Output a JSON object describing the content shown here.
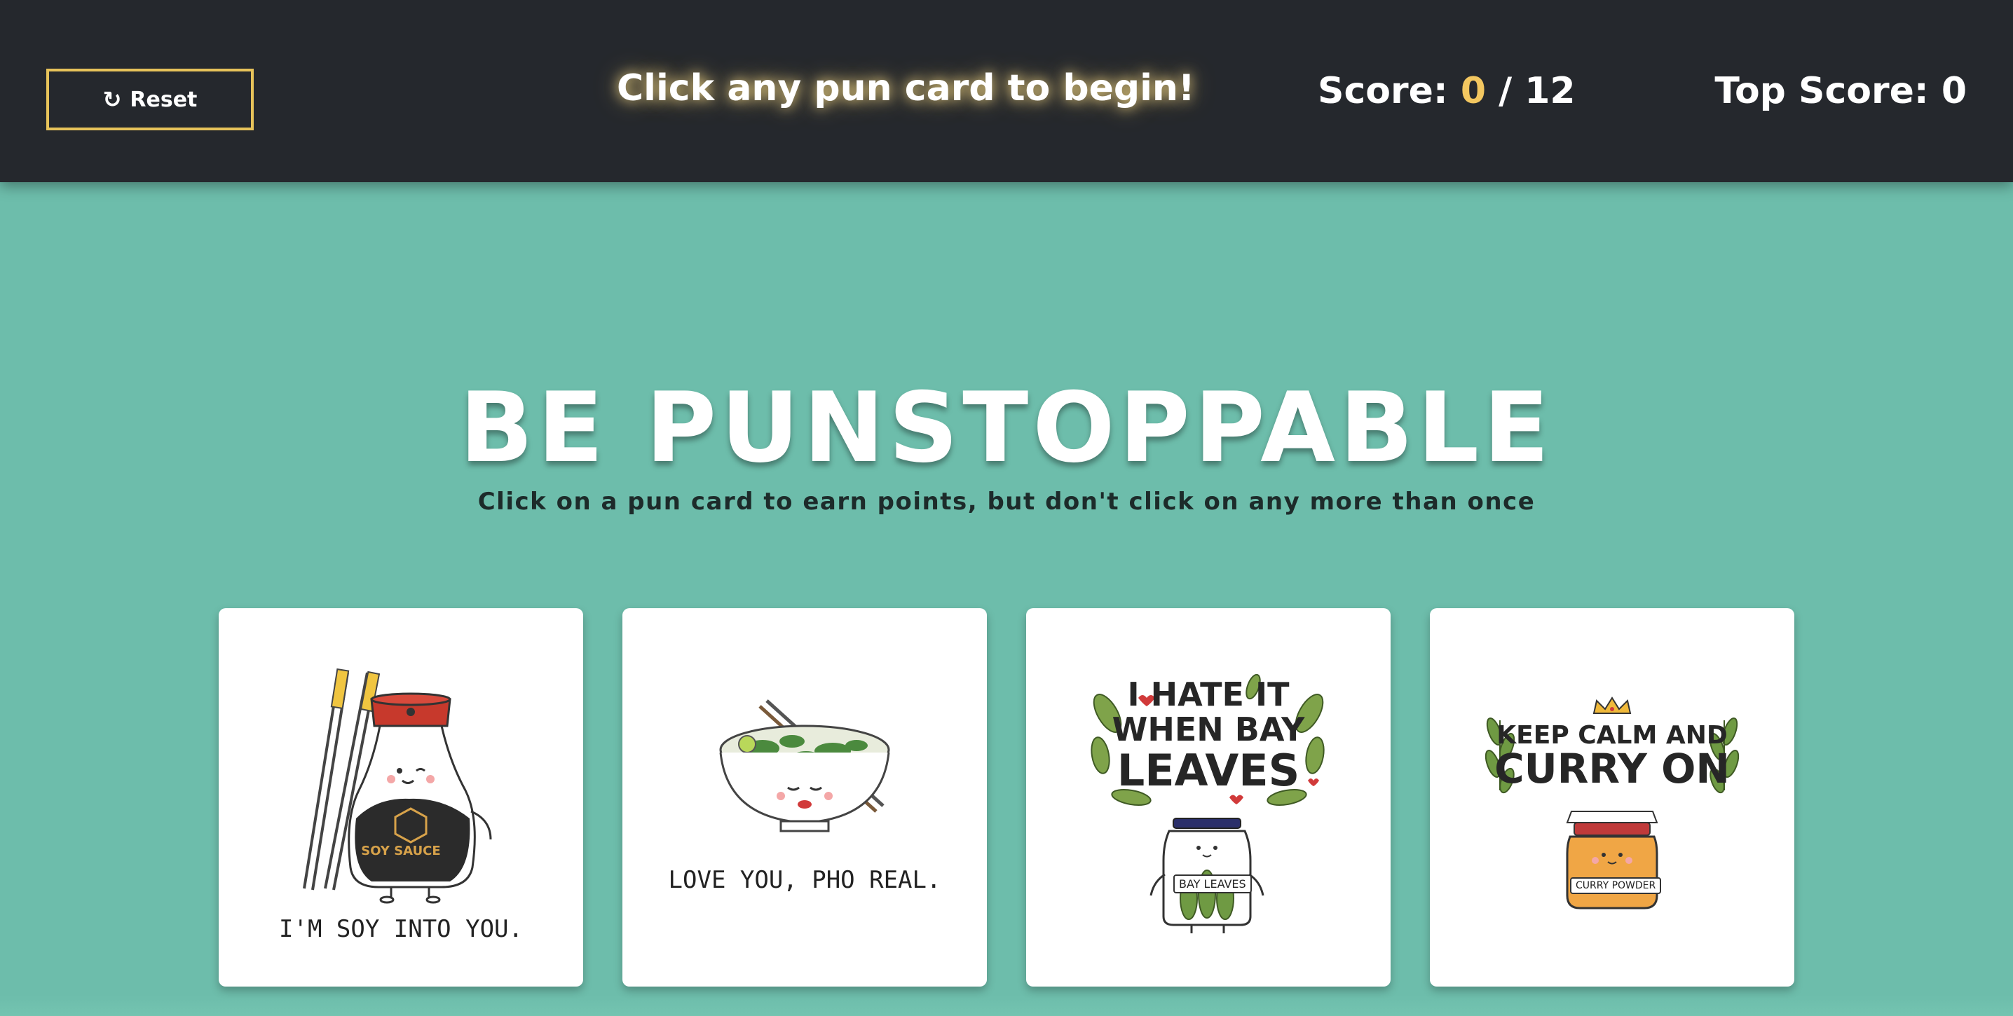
{
  "navbar": {
    "reset_label": "Reset",
    "reset_icon": "refresh-icon",
    "message": "Click any pun card to begin!",
    "score_label": "Score: ",
    "score_current": "0",
    "score_separator": " / ",
    "score_total": "12",
    "top_score_label": "Top Score: ",
    "top_score_value": "0"
  },
  "hero": {
    "title": "BE PUNSTOPPABLE",
    "subtitle": "Click on a pun card to earn points, but don't click on any more than once"
  },
  "cards": [
    {
      "caption": "I'M SOY INTO YOU.",
      "bottle_label": "SOY SAUCE",
      "icon": "soy-sauce-illustration"
    },
    {
      "caption": "LOVE YOU, PHO REAL.",
      "icon": "pho-bowl-illustration"
    },
    {
      "line1": "I HATE IT",
      "line2": "WHEN BAY",
      "line3": "LEAVES",
      "jar_label": "BAY LEAVES",
      "icon": "bay-leaves-jar-illustration"
    },
    {
      "line1": "KEEP CALM AND",
      "line2": "CURRY ON",
      "jar_label": "CURRY POWDER",
      "icon": "curry-powder-jar-illustration"
    }
  ],
  "colors": {
    "background": "#6dbdab",
    "navbar": "#25282d",
    "accent": "#e7c35a",
    "score_highlight": "#f3c760"
  }
}
